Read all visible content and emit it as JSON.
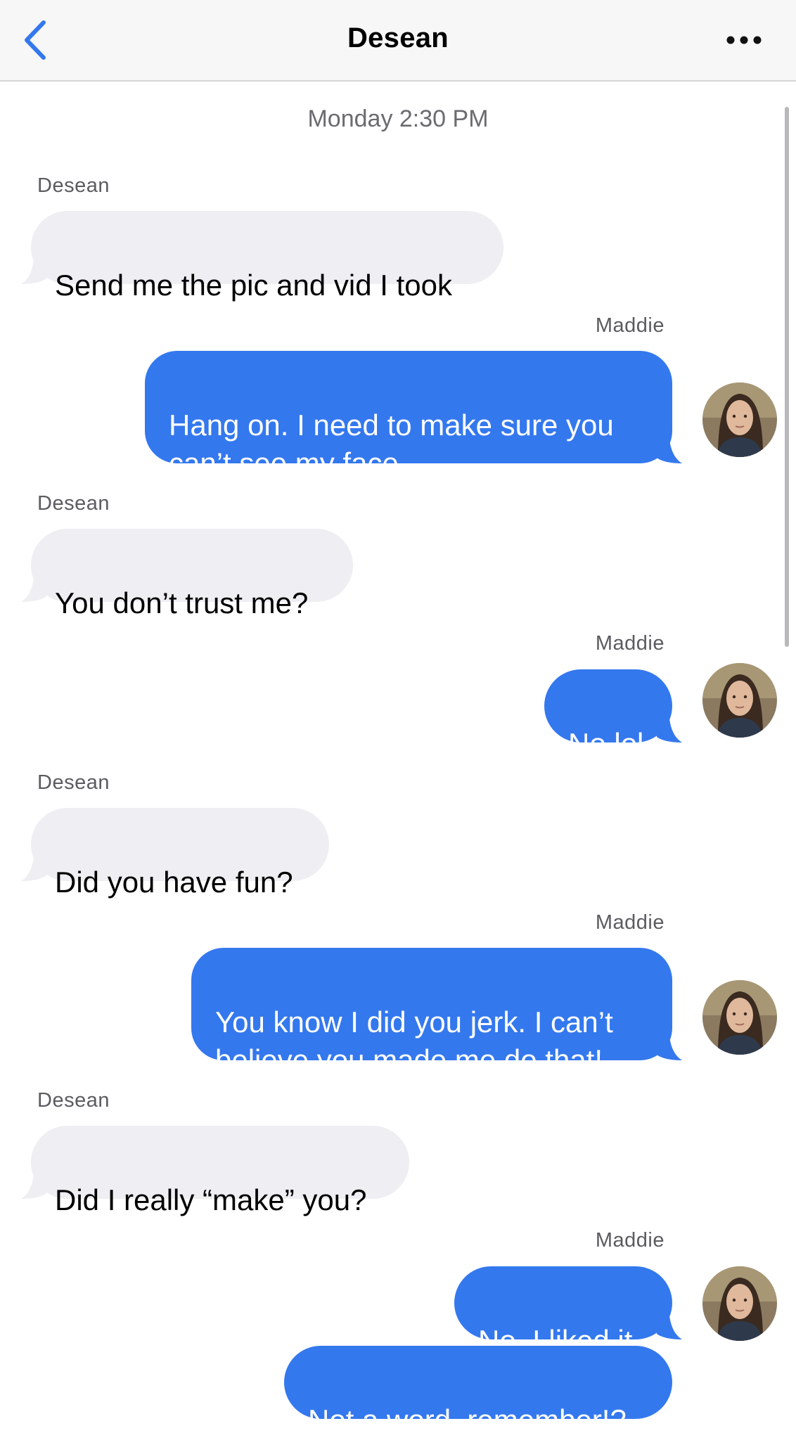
{
  "header": {
    "back_icon": "chevron-left-icon",
    "title": "Desean",
    "more_icon": "ellipsis-icon"
  },
  "colors": {
    "outgoing_bubble": "#3478ee",
    "incoming_bubble": "#eeeef3",
    "accent": "#3478ee",
    "header_bg": "#f7f7f7"
  },
  "conversation": {
    "timestamp": "Monday 2:30 PM",
    "messages": [
      {
        "sender": "Desean",
        "direction": "incoming",
        "text": "Send me the pic and vid I took"
      },
      {
        "sender": "Maddie",
        "direction": "outgoing",
        "text": "Hang on. I need to make sure you\ncan’t see my face."
      },
      {
        "sender": "Desean",
        "direction": "incoming",
        "text": "You don’t trust me?"
      },
      {
        "sender": "Maddie",
        "direction": "outgoing",
        "text": "No lol"
      },
      {
        "sender": "Desean",
        "direction": "incoming",
        "text": "Did you have fun?"
      },
      {
        "sender": "Maddie",
        "direction": "outgoing",
        "text": "You know I did you jerk. I can’t\nbelieve you made me do that!"
      },
      {
        "sender": "Desean",
        "direction": "incoming",
        "text": "Did I really “make” you?"
      },
      {
        "sender": "Maddie",
        "direction": "outgoing",
        "text": "No. I liked it."
      },
      {
        "sender": "Maddie",
        "direction": "outgoing",
        "text": "Not a word, remember!?"
      }
    ]
  }
}
